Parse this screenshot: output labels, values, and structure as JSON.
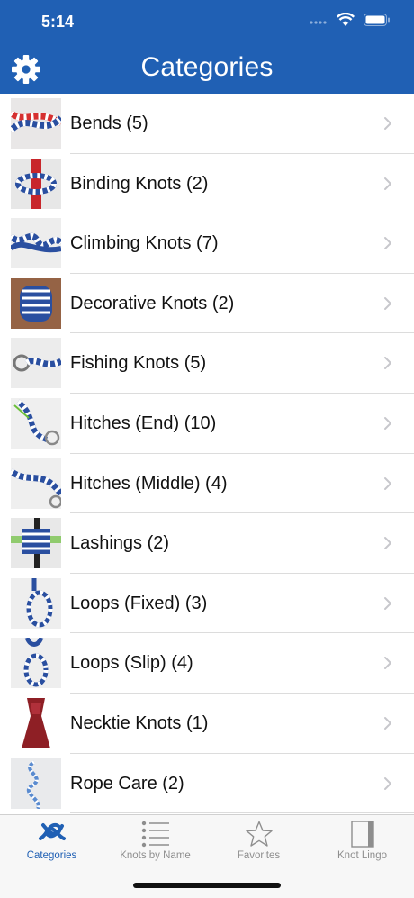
{
  "status_bar": {
    "time": "5:14"
  },
  "nav": {
    "title": "Categories"
  },
  "colors": {
    "nav_bar": "#2060b4",
    "active_tab": "#2060b4",
    "inactive_tab": "#8e8e8e",
    "chevron": "#c7c7cc"
  },
  "categories": [
    {
      "label": "Bends (5)",
      "thumb": "bends"
    },
    {
      "label": "Binding Knots (2)",
      "thumb": "binding"
    },
    {
      "label": "Climbing Knots (7)",
      "thumb": "climbing"
    },
    {
      "label": "Decorative Knots (2)",
      "thumb": "decorative"
    },
    {
      "label": "Fishing Knots (5)",
      "thumb": "fishing"
    },
    {
      "label": "Hitches (End) (10)",
      "thumb": "hitches-end"
    },
    {
      "label": "Hitches (Middle) (4)",
      "thumb": "hitches-middle"
    },
    {
      "label": "Lashings (2)",
      "thumb": "lashings"
    },
    {
      "label": "Loops (Fixed) (3)",
      "thumb": "loops-fixed"
    },
    {
      "label": "Loops (Slip) (4)",
      "thumb": "loops-slip"
    },
    {
      "label": "Necktie Knots (1)",
      "thumb": "necktie"
    },
    {
      "label": "Rope Care (2)",
      "thumb": "rope-care"
    }
  ],
  "tabs": [
    {
      "label": "Categories",
      "icon": "knot-icon",
      "active": true
    },
    {
      "label": "Knots by Name",
      "icon": "list-icon",
      "active": false
    },
    {
      "label": "Favorites",
      "icon": "star-icon",
      "active": false
    },
    {
      "label": "Knot Lingo",
      "icon": "book-icon",
      "active": false
    }
  ]
}
